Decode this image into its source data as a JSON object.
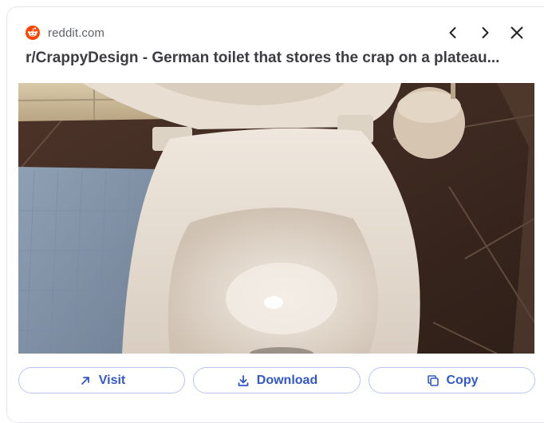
{
  "source": {
    "name": "reddit.com",
    "icon": "reddit-logo-icon",
    "brand_color": "#ff4500"
  },
  "nav": {
    "prev_icon": "chevron-left-icon",
    "next_icon": "chevron-right-icon",
    "close_icon": "close-icon"
  },
  "title": "r/CrappyDesign - German toilet that stores the crap on a plateau...",
  "image": {
    "subject": "toilet-photo"
  },
  "actions": {
    "visit_label": "Visit",
    "visit_icon": "arrow-up-right-icon",
    "download_label": "Download",
    "download_icon": "download-icon",
    "copy_label": "Copy",
    "copy_icon": "copy-icon",
    "accent_color": "#3258c9",
    "border_color": "#b9c6ee"
  }
}
